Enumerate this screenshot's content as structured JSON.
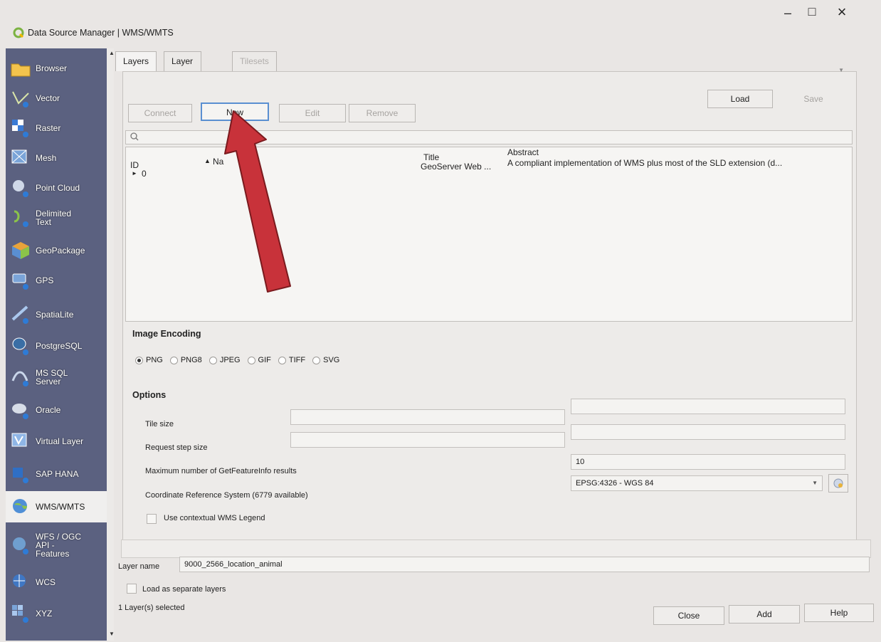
{
  "window": {
    "title": "Data Source Manager | WMS/WMTS",
    "minimize": "–",
    "maximize": "□",
    "close": "×"
  },
  "sidebar": {
    "items": [
      {
        "label": "Browser",
        "icon": "folder-icon"
      },
      {
        "label": "Vector",
        "icon": "vector-icon"
      },
      {
        "label": "Raster",
        "icon": "raster-icon"
      },
      {
        "label": "Mesh",
        "icon": "mesh-icon"
      },
      {
        "label": "Point Cloud",
        "icon": "point-cloud-icon"
      },
      {
        "label": "Delimited\nText",
        "icon": "delimited-text-icon"
      },
      {
        "label": "GeoPackage",
        "icon": "geopackage-icon"
      },
      {
        "label": "GPS",
        "icon": "gps-icon"
      },
      {
        "label": "SpatiaLite",
        "icon": "spatialite-icon"
      },
      {
        "label": "PostgreSQL",
        "icon": "postgresql-icon"
      },
      {
        "label": "MS SQL\nServer",
        "icon": "mssql-icon"
      },
      {
        "label": "Oracle",
        "icon": "oracle-icon"
      },
      {
        "label": "Virtual Layer",
        "icon": "virtual-layer-icon"
      },
      {
        "label": "SAP HANA",
        "icon": "sap-hana-icon"
      },
      {
        "label": "WMS/WMTS",
        "icon": "wms-icon"
      },
      {
        "label": "WFS / OGC\nAPI -\nFeatures",
        "icon": "wfs-icon"
      },
      {
        "label": "WCS",
        "icon": "wcs-icon"
      },
      {
        "label": "XYZ",
        "icon": "xyz-icon"
      }
    ],
    "active": "WMS/WMTS"
  },
  "tabs": [
    {
      "label": "Layers"
    },
    {
      "label": "Layer Order"
    },
    {
      "label": "Tilesets"
    }
  ],
  "toolbar": {
    "connect": "Connect",
    "new": "New",
    "edit": "Edit",
    "remove": "Remove",
    "load": "Load",
    "save": "Save"
  },
  "table": {
    "headers": {
      "id": "ID",
      "name": "Na",
      "title": "Title",
      "abstract": "Abstract"
    },
    "rows": [
      {
        "id": "0",
        "name": "",
        "title": "GeoServer Web ...",
        "abstract": "A compliant implementation of WMS plus most of the SLD extension (d..."
      }
    ]
  },
  "image_encoding": {
    "title": "Image Encoding",
    "options": [
      "PNG",
      "PNG8",
      "JPEG",
      "GIF",
      "TIFF",
      "SVG"
    ],
    "selected": "PNG"
  },
  "options": {
    "title": "Options",
    "tile_size_label": "Tile size",
    "request_step_label": "Request step size",
    "max_getfeatureinfo_label": "Maximum number of GetFeatureInfo results",
    "max_getfeatureinfo_value": "10",
    "crs_label": "Coordinate Reference System (6779 available)",
    "crs_value": "EPSG:4326 - WGS 84",
    "contextual_legend_label": "Use contextual WMS Legend"
  },
  "bottom": {
    "layer_name_label": "Layer name",
    "layer_name_value": "9000_2566_location_animal",
    "separate_layers_label": "Load as separate layers",
    "status": "1 Layer(s) selected",
    "close": "Close",
    "add": "Add",
    "help": "Help"
  },
  "colors": {
    "sidebar_bg": "#5b6180",
    "annotation_arrow": "#c8323a",
    "focus_border": "#5a8fd1"
  }
}
